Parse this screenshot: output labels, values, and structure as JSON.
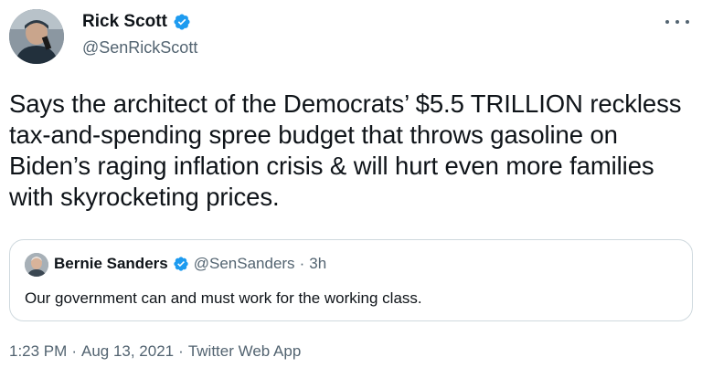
{
  "author": {
    "name": "Rick Scott",
    "handle": "@SenRickScott"
  },
  "tweet": {
    "text": "Says the architect of the Democrats’ $5.5 TRILLION reckless tax-and-spending spree budget that throws gasoline on Biden’s raging inflation crisis & will hurt even more families with skyrocketing prices."
  },
  "quoted": {
    "name": "Bernie Sanders",
    "handle": "@SenSanders",
    "separator": "·",
    "time": "3h",
    "text": "Our government can and must work for the working class."
  },
  "meta": {
    "time": "1:23 PM",
    "sep1": "·",
    "date": "Aug 13, 2021",
    "sep2": "·",
    "source": "Twitter Web App"
  },
  "icons": {
    "verified": "verified-badge-icon",
    "more": "more-options-icon"
  },
  "colors": {
    "verified": "#1d9bf0",
    "secondary_text": "#536471",
    "border": "#cfd9de"
  }
}
